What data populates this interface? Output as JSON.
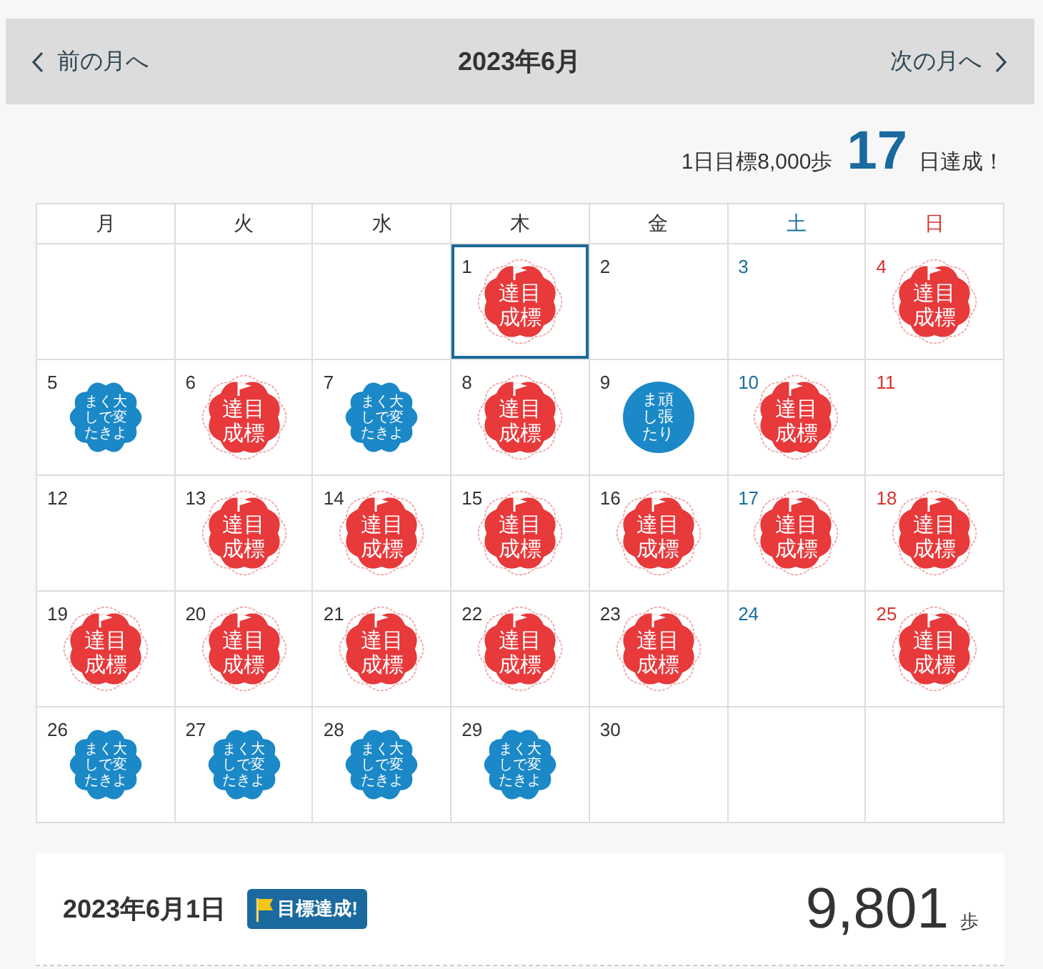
{
  "header": {
    "prev": {
      "label": "前の月へ"
    },
    "title": "2023年6月",
    "next": {
      "label": "次の月へ"
    }
  },
  "summary": {
    "goal_text": "1日目標8,000歩",
    "achieved_count": "17",
    "achieved_suffix": "日達成！"
  },
  "calendar": {
    "weekdays": [
      {
        "label": "月",
        "color": "#333333"
      },
      {
        "label": "火",
        "color": "#333333"
      },
      {
        "label": "水",
        "color": "#333333"
      },
      {
        "label": "木",
        "color": "#333333"
      },
      {
        "label": "金",
        "color": "#333333"
      },
      {
        "label": "土",
        "color": "#1a6fa0"
      },
      {
        "label": "日",
        "color": "#d7332e"
      }
    ],
    "weeks": [
      [
        {
          "day": "1",
          "selected": true,
          "stamp": {
            "kind": "goal",
            "label": "目標達成"
          }
        },
        {
          "day": "2",
          "selected": false
        },
        {
          "day": "3",
          "selected": false
        },
        {
          "day": "4",
          "selected": false,
          "stamp": {
            "kind": "goal",
            "label": "目標達成"
          }
        }
      ],
      [
        {
          "day": "5",
          "selected": false,
          "stamp": {
            "kind": "excellent",
            "label": "大変よくできました"
          }
        },
        {
          "day": "6",
          "selected": false,
          "stamp": {
            "kind": "goal",
            "label": "目標達成"
          }
        },
        {
          "day": "7",
          "selected": false,
          "stamp": {
            "kind": "excellent",
            "label": "大変よくできました"
          }
        },
        {
          "day": "8",
          "selected": false,
          "stamp": {
            "kind": "goal",
            "label": "目標達成"
          }
        },
        {
          "day": "9",
          "selected": false,
          "stamp": {
            "kind": "effort",
            "label": "頑張りました"
          }
        },
        {
          "day": "10",
          "selected": false,
          "stamp": {
            "kind": "goal",
            "label": "目標達成"
          }
        },
        {
          "day": "11",
          "selected": false
        }
      ],
      [
        {
          "day": "12",
          "selected": false
        },
        {
          "day": "13",
          "selected": false,
          "stamp": {
            "kind": "goal",
            "label": "目標達成"
          }
        },
        {
          "day": "14",
          "selected": false,
          "stamp": {
            "kind": "goal",
            "label": "目標達成"
          }
        },
        {
          "day": "15",
          "selected": false,
          "stamp": {
            "kind": "goal",
            "label": "目標達成"
          }
        },
        {
          "day": "16",
          "selected": false,
          "stamp": {
            "kind": "goal",
            "label": "目標達成"
          }
        },
        {
          "day": "17",
          "selected": false,
          "stamp": {
            "kind": "goal",
            "label": "目標達成"
          }
        },
        {
          "day": "18",
          "selected": false,
          "stamp": {
            "kind": "goal",
            "label": "目標達成"
          }
        }
      ],
      [
        {
          "day": "19",
          "selected": false,
          "stamp": {
            "kind": "goal",
            "label": "目標達成"
          }
        },
        {
          "day": "20",
          "selected": false,
          "stamp": {
            "kind": "goal",
            "label": "目標達成"
          }
        },
        {
          "day": "21",
          "selected": false,
          "stamp": {
            "kind": "goal",
            "label": "目標達成"
          }
        },
        {
          "day": "22",
          "selected": false,
          "stamp": {
            "kind": "goal",
            "label": "目標達成"
          }
        },
        {
          "day": "23",
          "selected": false,
          "stamp": {
            "kind": "goal",
            "label": "目標達成"
          }
        },
        {
          "day": "24",
          "selected": false
        },
        {
          "day": "25",
          "selected": false,
          "stamp": {
            "kind": "goal",
            "label": "目標達成"
          }
        }
      ],
      [
        {
          "day": "26",
          "selected": false,
          "stamp": {
            "kind": "excellent",
            "label": "大変よくできました"
          }
        },
        {
          "day": "27",
          "selected": false,
          "stamp": {
            "kind": "excellent",
            "label": "大変よくできました"
          }
        },
        {
          "day": "28",
          "selected": false,
          "stamp": {
            "kind": "excellent",
            "label": "大変よくできました"
          }
        },
        {
          "day": "29",
          "selected": false,
          "stamp": {
            "kind": "excellent",
            "label": "大変よくできました"
          }
        },
        {
          "day": "30",
          "selected": false
        }
      ]
    ]
  },
  "detail": {
    "date": "2023年6月1日",
    "badge": "目標達成!",
    "steps": "9,801",
    "unit": "歩"
  }
}
